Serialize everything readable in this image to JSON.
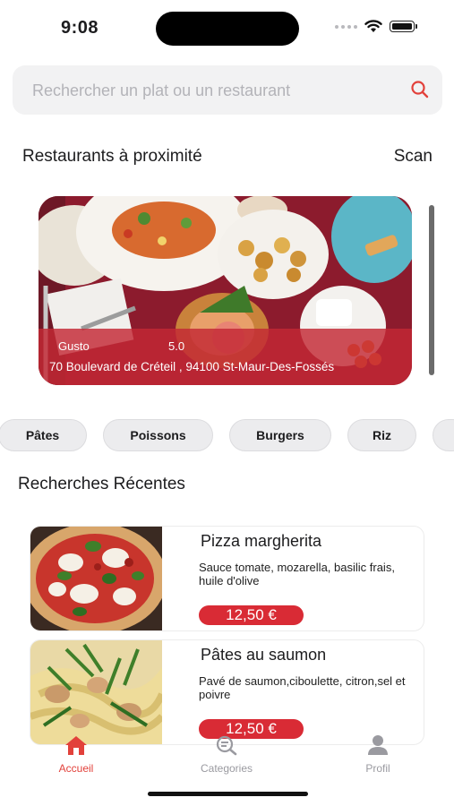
{
  "status": {
    "time": "9:08"
  },
  "search": {
    "placeholder": "Rechercher un plat ou un restaurant"
  },
  "nearby": {
    "title": "Restaurants à proximité",
    "scan_label": "Scan",
    "card": {
      "name": "Gusto",
      "rating": "5.0",
      "address": "70 Boulevard de Créteil , 94100 St-Maur-Des-Fossés"
    }
  },
  "categories": [
    "Pâtes",
    "Poissons",
    "Burgers",
    "Riz"
  ],
  "recent": {
    "title": "Recherches Récentes",
    "items": [
      {
        "name": "Pizza margherita",
        "description": "Sauce tomate, mozarella, basilic frais, huile d'olive",
        "price": "12,50 €"
      },
      {
        "name": "Pâtes au saumon",
        "description": "Pavé de saumon,ciboulette, citron,sel et poivre",
        "price": "12,50 €"
      }
    ]
  },
  "nav": {
    "items": [
      {
        "label": "Accueil",
        "icon": "home-icon"
      },
      {
        "label": "Categories",
        "icon": "search-list-icon"
      },
      {
        "label": "Profil",
        "icon": "person-icon"
      }
    ]
  },
  "colors": {
    "accent": "#d92b35",
    "nav_inactive": "#9a9aa0",
    "chip_bg": "#ececee"
  }
}
